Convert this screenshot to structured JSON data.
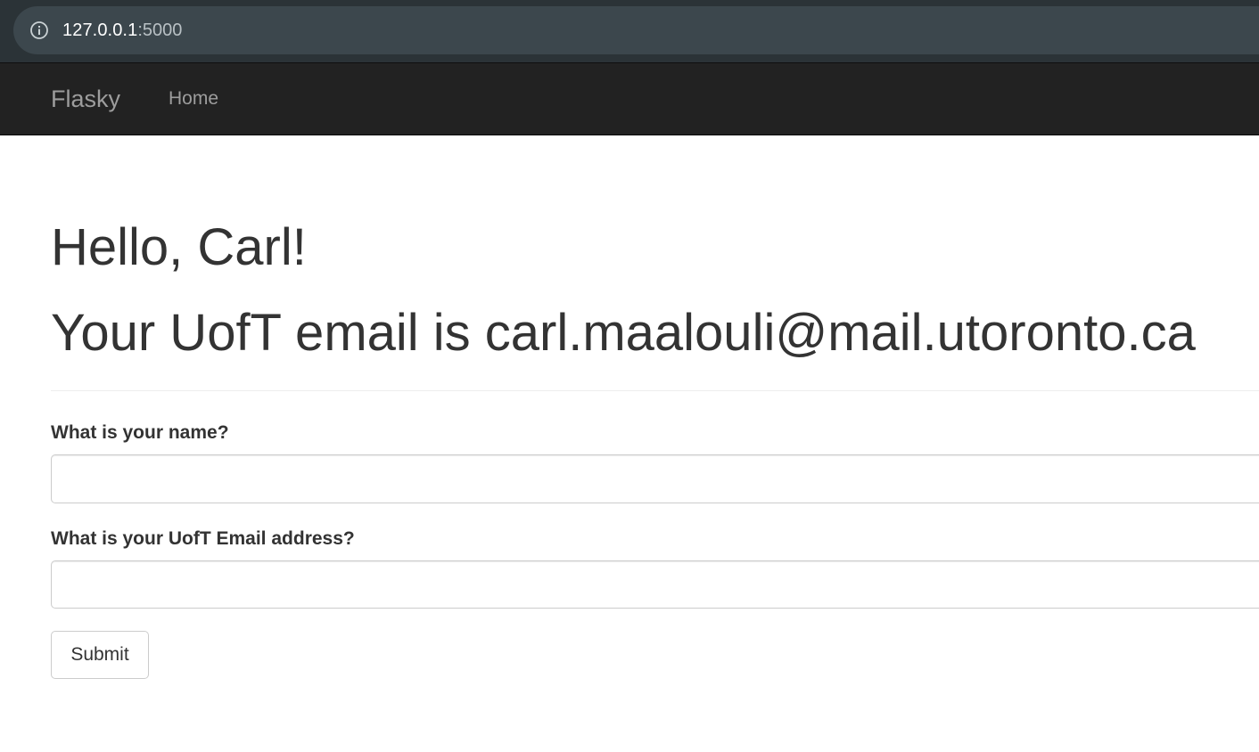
{
  "browser": {
    "url_host": "127.0.0.1",
    "url_port": ":5000",
    "info_icon": "info-icon"
  },
  "navbar": {
    "brand": "Flasky",
    "links": [
      {
        "label": "Home"
      }
    ]
  },
  "main": {
    "greeting": "Hello, Carl!",
    "email_message": "Your UofT email is carl.maalouli@mail.utoronto.ca"
  },
  "form": {
    "name_label": "What is your name?",
    "name_value": "",
    "email_label": "What is your UofT Email address?",
    "email_value": "",
    "submit_label": "Submit"
  },
  "colors": {
    "navbar_bg": "#222222",
    "navbar_text": "#9d9d9d",
    "browser_bar_bg": "#3c474d",
    "text": "#333333"
  }
}
